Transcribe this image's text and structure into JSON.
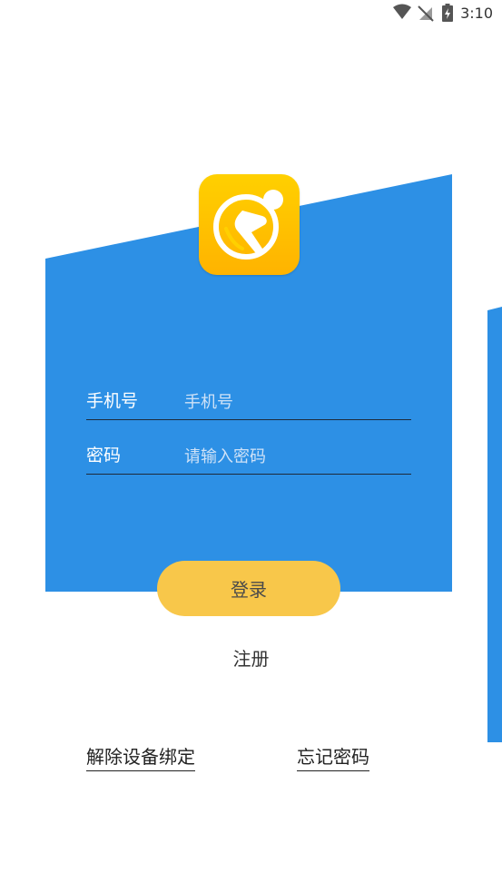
{
  "status_bar": {
    "time": "3:10",
    "icons": [
      "wifi-icon",
      "no-sim-icon",
      "battery-charging-icon"
    ]
  },
  "logo": {
    "icon": "runner-app-logo",
    "gradient_top": "#ffd000",
    "gradient_bottom": "#ffb300"
  },
  "form": {
    "phone": {
      "label": "手机号",
      "placeholder": "手机号",
      "value": ""
    },
    "password": {
      "label": "密码",
      "placeholder": "请输入密码",
      "value": ""
    }
  },
  "actions": {
    "login_label": "登录",
    "register_label": "注册",
    "unbind_device_label": "解除设备绑定",
    "forgot_password_label": "忘记密码"
  },
  "colors": {
    "panel_blue": "#2d90e5",
    "button_yellow": "#f8c74a",
    "background": "#ffffff"
  }
}
